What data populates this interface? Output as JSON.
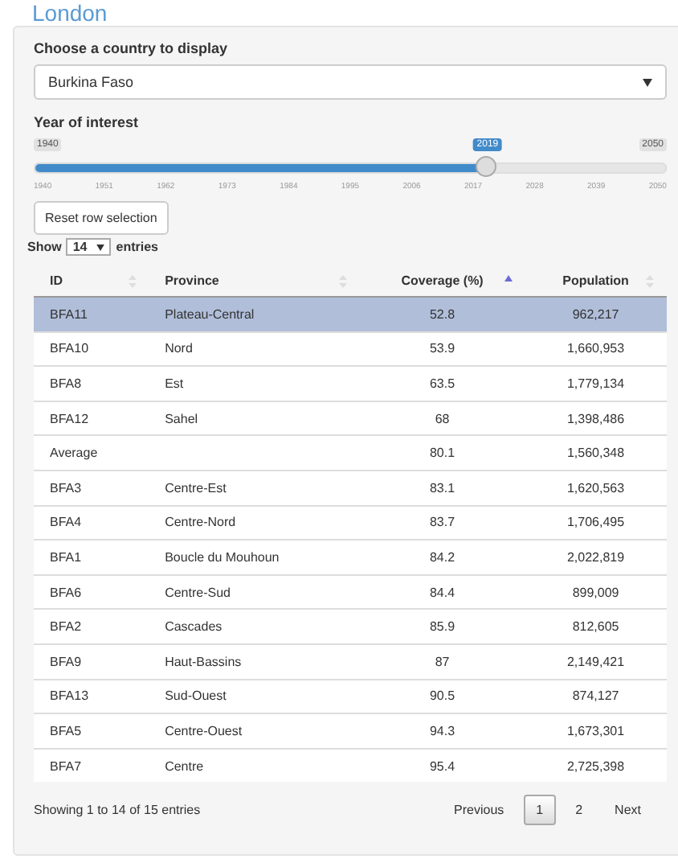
{
  "heading": "London",
  "country": {
    "label": "Choose a country to display",
    "value": "Burkina Faso"
  },
  "slider": {
    "label": "Year of interest",
    "min": "1940",
    "max": "2050",
    "value": "2019",
    "level": 0.718,
    "ticks": [
      "1940",
      "1951",
      "1962",
      "1973",
      "1984",
      "1995",
      "2006",
      "2017",
      "2028",
      "2039",
      "2050"
    ]
  },
  "reset_button": "Reset row selection",
  "length": {
    "before": "Show",
    "value": "14",
    "after": "entries"
  },
  "table": {
    "columns": [
      {
        "label": "ID",
        "kind": "text",
        "sorted": false
      },
      {
        "label": "Province",
        "kind": "text",
        "sorted": false
      },
      {
        "label": "Coverage (%)",
        "kind": "number",
        "sorted": true
      },
      {
        "label": "Population",
        "kind": "number",
        "sorted": false
      }
    ],
    "rows": [
      {
        "cells": [
          "BFA11",
          "Plateau-Central",
          "52.8",
          "962,217"
        ],
        "selected": true
      },
      {
        "cells": [
          "BFA10",
          "Nord",
          "53.9",
          "1,660,953"
        ],
        "selected": false
      },
      {
        "cells": [
          "BFA8",
          "Est",
          "63.5",
          "1,779,134"
        ],
        "selected": false
      },
      {
        "cells": [
          "BFA12",
          "Sahel",
          "68",
          "1,398,486"
        ],
        "selected": false
      },
      {
        "cells": [
          "Average",
          "",
          "80.1",
          "1,560,348"
        ],
        "selected": false
      },
      {
        "cells": [
          "BFA3",
          "Centre-Est",
          "83.1",
          "1,620,563"
        ],
        "selected": false
      },
      {
        "cells": [
          "BFA4",
          "Centre-Nord",
          "83.7",
          "1,706,495"
        ],
        "selected": false
      },
      {
        "cells": [
          "BFA1",
          "Boucle du Mouhoun",
          "84.2",
          "2,022,819"
        ],
        "selected": false
      },
      {
        "cells": [
          "BFA6",
          "Centre-Sud",
          "84.4",
          "899,009"
        ],
        "selected": false
      },
      {
        "cells": [
          "BFA2",
          "Cascades",
          "85.9",
          "812,605"
        ],
        "selected": false
      },
      {
        "cells": [
          "BFA9",
          "Haut-Bassins",
          "87",
          "2,149,421"
        ],
        "selected": false
      },
      {
        "cells": [
          "BFA13",
          "Sud-Ouest",
          "90.5",
          "874,127"
        ],
        "selected": false
      },
      {
        "cells": [
          "BFA5",
          "Centre-Ouest",
          "94.3",
          "1,673,301"
        ],
        "selected": false
      },
      {
        "cells": [
          "BFA7",
          "Centre",
          "95.4",
          "2,725,398"
        ],
        "selected": false
      }
    ]
  },
  "info": "Showing 1 to 14 of 15 entries",
  "pagination": [
    {
      "label": "Previous",
      "selected": false
    },
    {
      "label": "1",
      "selected": true
    },
    {
      "label": "2",
      "selected": false
    },
    {
      "label": "Next",
      "selected": false
    }
  ]
}
